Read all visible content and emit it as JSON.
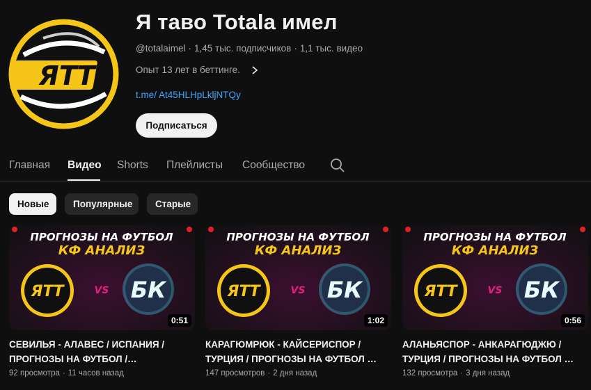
{
  "channel": {
    "title": "Я таво Totala имел",
    "handle": "@totalaimel",
    "subscribers": "1,45 тыс. подписчиков",
    "videos_count": "1,1 тыс. видео",
    "separator": "·",
    "description": "Опыт 13 лет в беттинге.",
    "link": "t.me/ At45HLHpLkljNTQy",
    "subscribe_label": "Подписаться",
    "avatar_text": "ЯТТ"
  },
  "tabs": [
    {
      "label": "Главная"
    },
    {
      "label": "Видео"
    },
    {
      "label": "Shorts"
    },
    {
      "label": "Плейлисты"
    },
    {
      "label": "Сообщество"
    }
  ],
  "active_tab": "Видео",
  "filters": [
    {
      "label": "Новые"
    },
    {
      "label": "Популярные"
    },
    {
      "label": "Старые"
    }
  ],
  "active_filter": "Новые",
  "thumbnail": {
    "line1": "ПРОГНОЗЫ НА ФУТБОЛ",
    "line2": "КФ АНАЛИЗ",
    "left_logo": "ЯТТ",
    "vs": "VS",
    "right_logo": "БК"
  },
  "videos": [
    {
      "title": "СЕВИЛЬЯ - АЛАВЕС / ИСПАНИЯ / ПРОГНОЗЫ НА ФУТБОЛ /…",
      "views": "92 просмотра",
      "age": "11 часов назад",
      "duration": "0:51"
    },
    {
      "title": "КАРАГЮМРЮК - КАЙСЕРИСПОР / ТУРЦИЯ / ПРОГНОЗЫ НА ФУТБОЛ …",
      "views": "147 просмотров",
      "age": "2 дня назад",
      "duration": "1:02"
    },
    {
      "title": "АЛАНЬЯСПОР - АНКАРАГЮДЖЮ / ТУРЦИЯ / ПРОГНОЗЫ НА ФУТБОЛ …",
      "views": "132 просмотра",
      "age": "3 дня назад",
      "duration": "0:56"
    }
  ],
  "colors": {
    "background": "#0f0f0f",
    "accent_yellow": "#f5c518",
    "link": "#3ea6ff",
    "thumb_magenta": "#e0207c",
    "thumb_cyan": "#3fe0ff"
  }
}
